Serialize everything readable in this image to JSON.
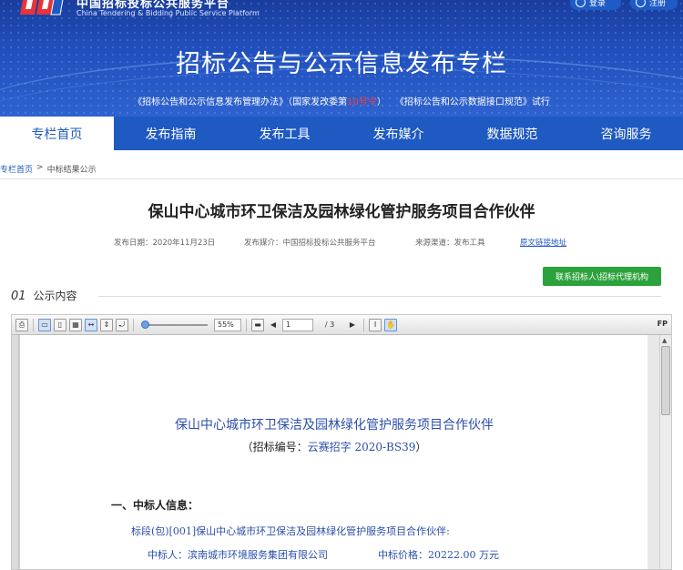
{
  "header": {
    "logo_cn": "中国招标投标公共服务平台",
    "logo_en": "China Tendering & Bidding Public Service Platform",
    "login_label": "登录",
    "register_label": "注册",
    "banner_title": "招标公告与公示信息发布专栏",
    "banner_note_a": "《招标公告和公示信息发布管理办法》（国家发改委第",
    "banner_note_red": "10号令",
    "banner_note_b": "）　　《招标公告和公示数据接口规范》试行"
  },
  "nav": {
    "items": [
      {
        "label": "专栏首页",
        "active": true
      },
      {
        "label": "发布指南",
        "active": false
      },
      {
        "label": "发布工具",
        "active": false
      },
      {
        "label": "发布媒介",
        "active": false
      },
      {
        "label": "数据规范",
        "active": false
      },
      {
        "label": "咨询服务",
        "active": false
      }
    ]
  },
  "breadcrumb": {
    "home": "专栏首页",
    "sep": ">",
    "current": "中标结果公示"
  },
  "article": {
    "title": "保山中心城市环卫保洁及园林绿化管护服务项目合作伙伴",
    "publish_date": "发布日期：2020年11月23日",
    "publish_media": "发布媒介：中国招标投标公共服务平台",
    "source_channel": "来源渠道：发布工具",
    "original_link": "原文链接地址",
    "contact_button": "联系招标人\\招标代理机构",
    "section_num": "01",
    "section_label": "公示内容"
  },
  "viewer": {
    "zoom": "55%",
    "page_current": "1",
    "page_total": "/ 3",
    "fp_label": "FP",
    "doc_title": "保山中心城市环卫保洁及园林绿化管护服务项目合作伙伴",
    "doc_sub_a": "（招标编号：",
    "doc_sub_blue": "云赛招字 2020-BS39",
    "doc_sub_b": "）",
    "heading1": "一、中标人信息：",
    "line1": "标段(包)[001]保山中心城市环卫保洁及园林绿化管护服务项目合作伙伴:",
    "line2a": "中标人：滨南城市环境服务集团有限公司",
    "line2b": "中标价格：20222.00 万元"
  },
  "colors": {
    "brand_blue": "#1f59c2",
    "banner_blue": "#2150bd",
    "contact_green": "#2ca23c",
    "note_red": "#ff3b3b"
  }
}
